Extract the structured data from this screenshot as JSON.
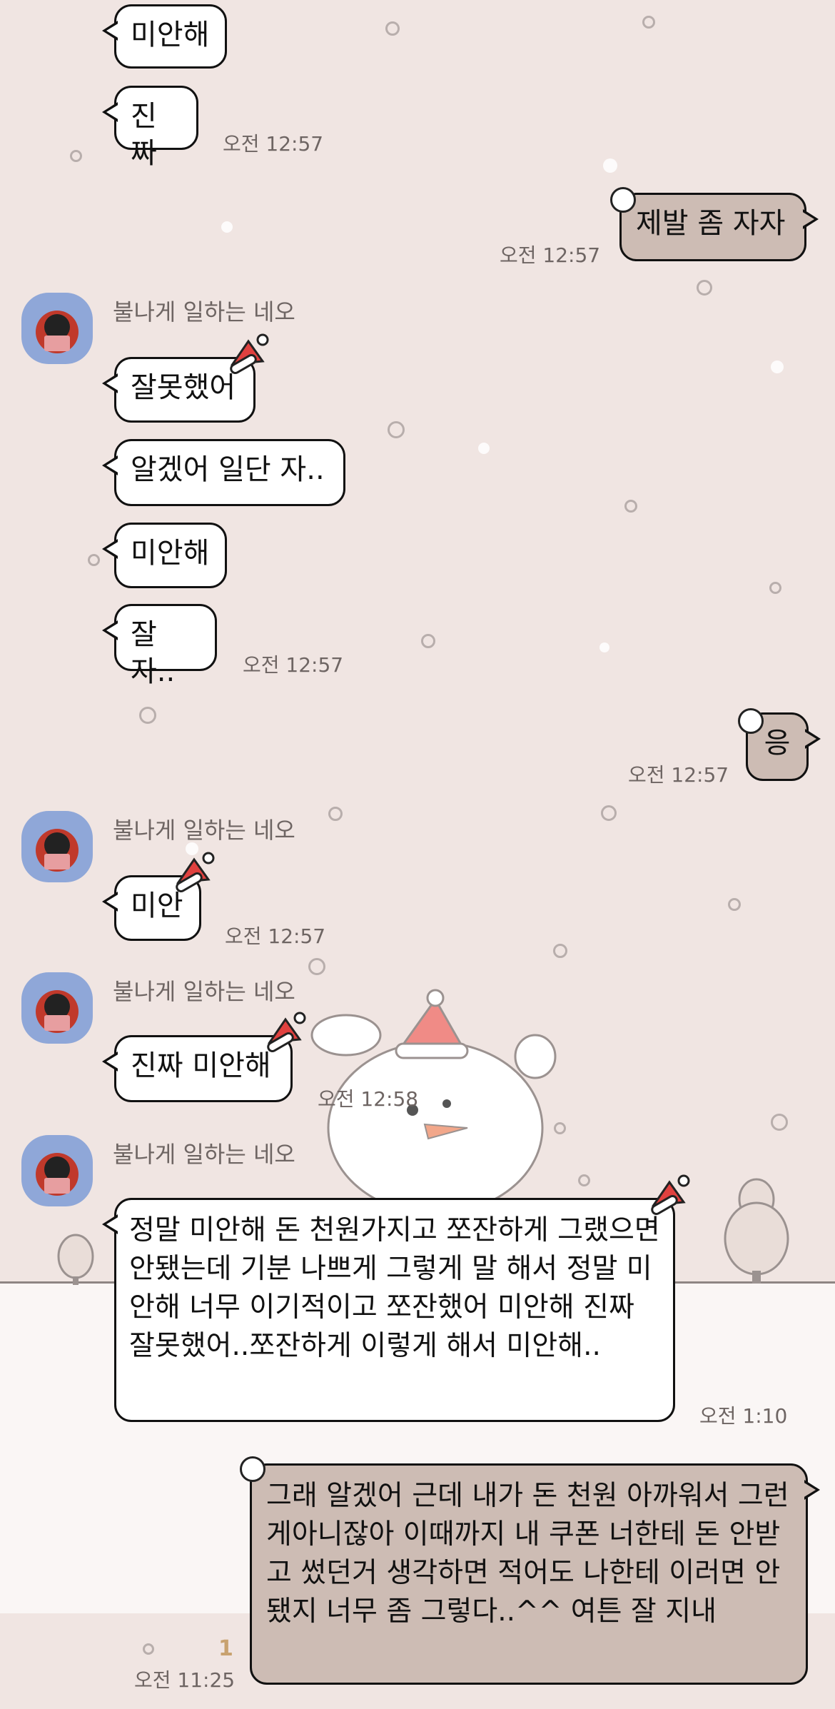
{
  "contact": {
    "name": "불나게 일하는 네오"
  },
  "messages": [
    {
      "side": "in",
      "text": "미안해"
    },
    {
      "side": "in",
      "text": "진짜",
      "time": "오전 12:57"
    },
    {
      "side": "out",
      "text": "제발 좀 자자",
      "time": "오전 12:57"
    },
    {
      "side": "in",
      "sender": "불나게 일하는 네오",
      "text": "잘못했어"
    },
    {
      "side": "in",
      "text": "알겠어 일단 자.."
    },
    {
      "side": "in",
      "text": "미안해"
    },
    {
      "side": "in",
      "text": "잘자..",
      "time": "오전 12:57"
    },
    {
      "side": "out",
      "text": "응",
      "time": "오전 12:57"
    },
    {
      "side": "in",
      "sender": "불나게 일하는 네오",
      "text": "미안",
      "time": "오전 12:57"
    },
    {
      "side": "in",
      "sender": "불나게 일하는 네오",
      "text": "진짜 미안해",
      "time": "오전 12:58"
    },
    {
      "side": "in",
      "sender": "불나게 일하는 네오",
      "text": "정말 미안해 돈 천원가지고 쪼잔하게 그랬으면 안됐는데 기분 나쁘게 그렇게 말 해서 정말 미안해 너무 이기적이고 쪼잔했어 미안해 진짜 잘못했어..쪼잔하게 이렇게 해서 미안해..",
      "time": "오전 1:10"
    },
    {
      "side": "out",
      "text": "그래 알겠어 근데 내가 돈 천원 아까워서 그런게아니잖아 이때까지 내 쿠폰 너한테 돈 안받고 썼던거 생각하면 적어도 나한테 이러면 안됐지 너무 좀 그렇다..^^ 여튼 잘 지내",
      "time": "오전 11:25",
      "unread": "1"
    }
  ],
  "theme": {
    "background": "#f0e5e2",
    "incoming_bubble": "#ffffff",
    "outgoing_bubble": "#cdbcb4",
    "time_color": "#6e6563",
    "unread_color": "#c8a26f",
    "avatar_bg": "#8fa7d8"
  }
}
